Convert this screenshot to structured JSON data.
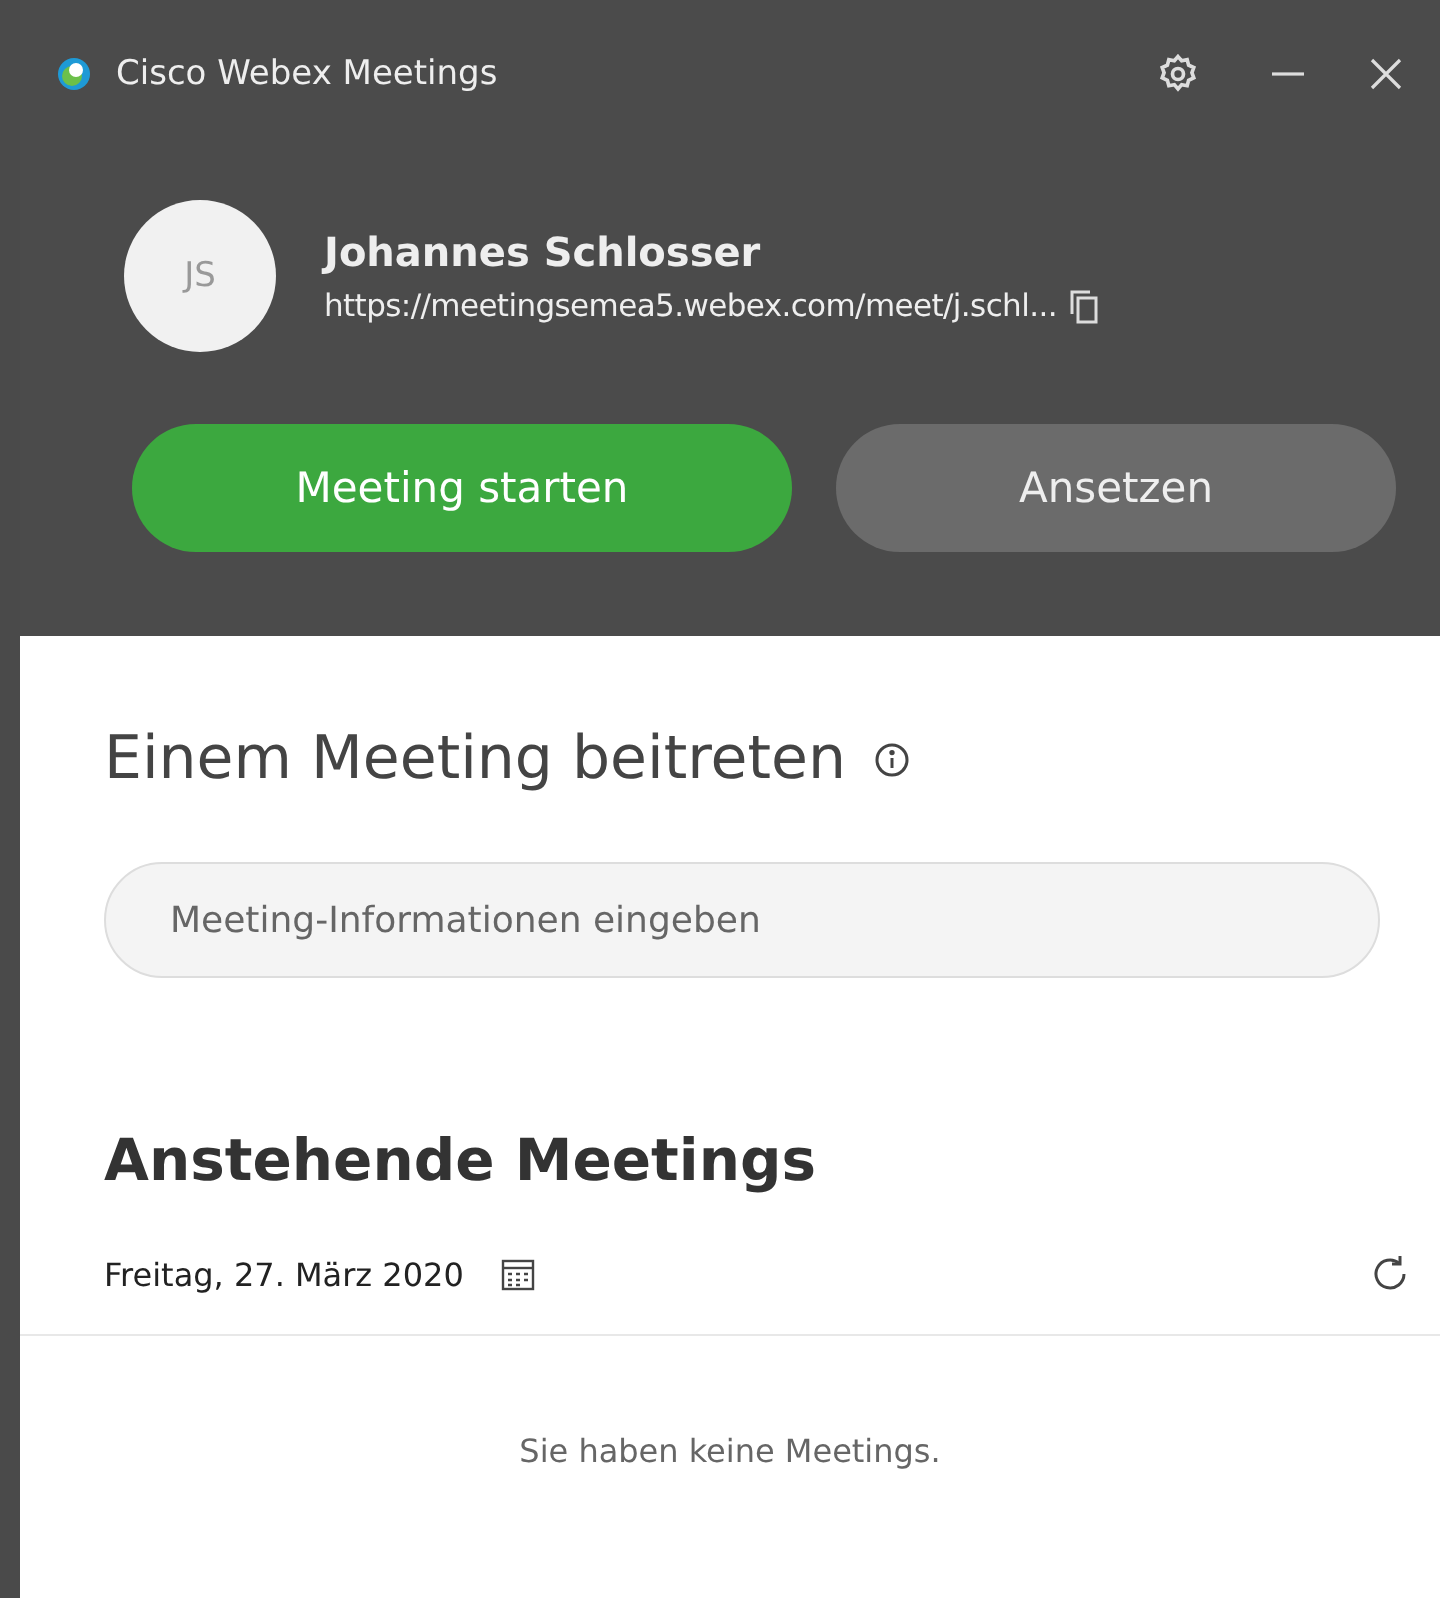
{
  "window": {
    "title": "Cisco Webex Meetings"
  },
  "profile": {
    "initials": "JS",
    "name": "Johannes Schlosser",
    "url": "https://meetingsemea5.webex.com/meet/j.schl..."
  },
  "actions": [
    {
      "label": "Meeting starten",
      "kind": "primary"
    },
    {
      "label": "Ansetzen",
      "kind": "secondary"
    }
  ],
  "join": {
    "heading": "Einem Meeting beitreten",
    "placeholder": "Meeting-Informationen eingeben"
  },
  "upcoming": {
    "heading": "Anstehende Meetings",
    "date": "Freitag, 27. März 2020",
    "empty_message": "Sie haben keine Meetings."
  }
}
